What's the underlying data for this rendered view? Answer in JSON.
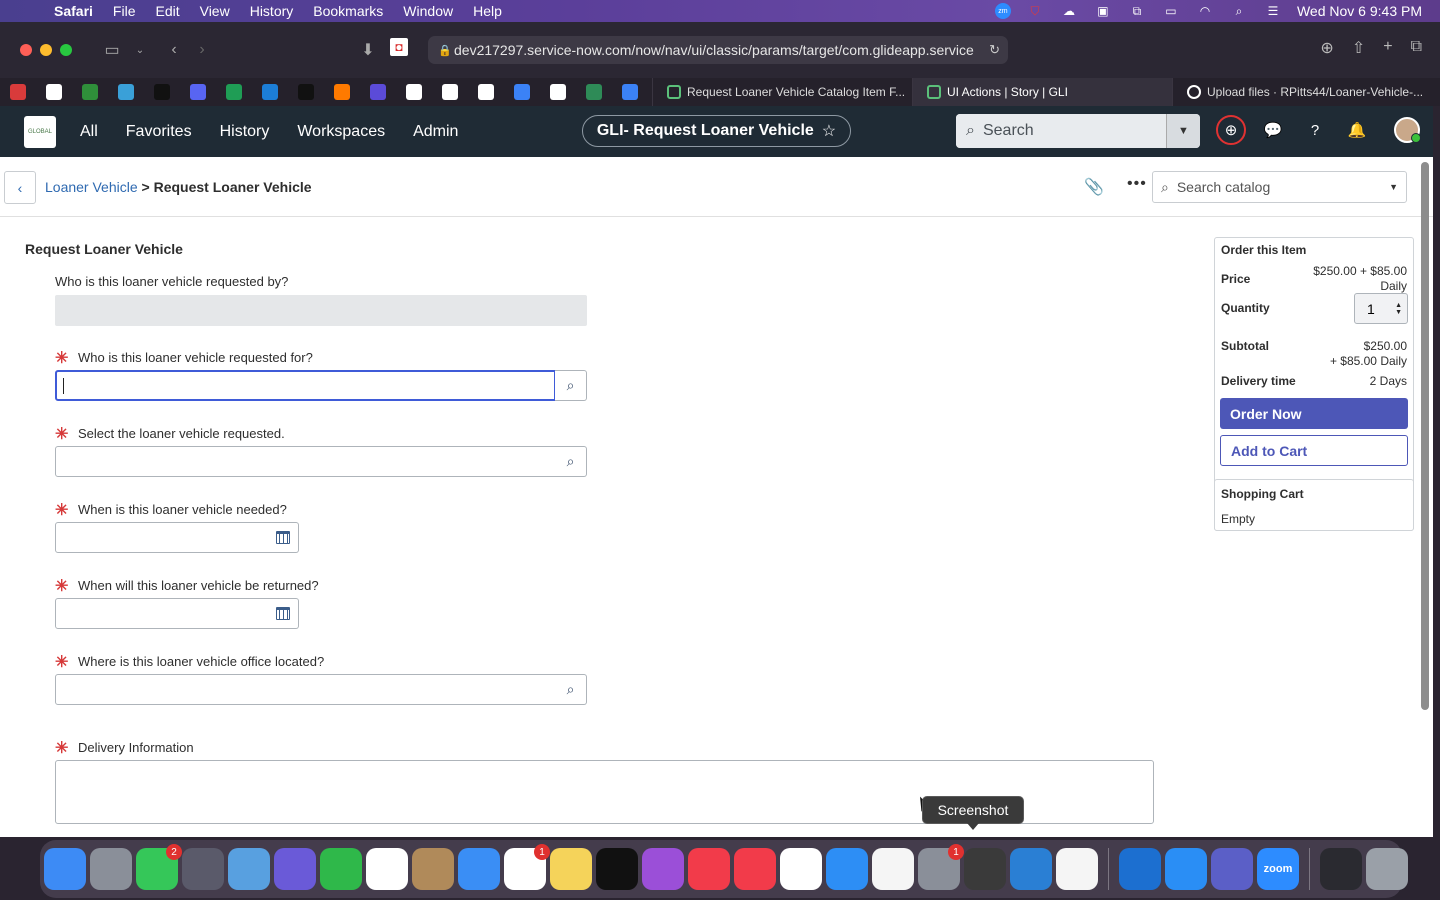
{
  "menubar": {
    "apple_glyph": "",
    "app": "Safari",
    "items": [
      "File",
      "Edit",
      "View",
      "History",
      "Bookmarks",
      "Window",
      "Help"
    ],
    "clock": "Wed Nov 6  9:43 PM"
  },
  "browser": {
    "url": "dev217297.service-now.com/now/nav/ui/classic/params/target/com.glideapp.service",
    "tabs": [
      {
        "title": "Request Loaner Vehicle Catalog Item F...",
        "active": false
      },
      {
        "title": "UI Actions | Story | GLI",
        "active": true
      },
      {
        "title": "Upload files · RPitts44/Loaner-Vehicle-...",
        "active": false
      }
    ],
    "favorite_colors": [
      "#d93b3b",
      "#ffffff",
      "#2f8f3a",
      "#3aa0d8",
      "#111111",
      "#5865f2",
      "#1f9d55",
      "#1c7ed6",
      "#111111",
      "#ff7a00",
      "#5b4bd8",
      "#ffffff",
      "#ffffff",
      "#ffffff",
      "#3b82f6",
      "#ffffff",
      "#2e8b57",
      "#3b82f6"
    ]
  },
  "sn_header": {
    "nav": [
      "All",
      "Favorites",
      "History",
      "Workspaces",
      "Admin"
    ],
    "title": "GLI- Request Loaner Vehicle",
    "search_placeholder": "Search",
    "logo_text": "GLOBAL"
  },
  "page": {
    "breadcrumb_parent": "Loaner Vehicle",
    "breadcrumb_sep": " > ",
    "breadcrumb_current": "Request Loaner Vehicle",
    "catalog_search_placeholder": "Search catalog",
    "form_title": "Request Loaner Vehicle",
    "questions": {
      "requested_by": "Who is this loaner vehicle requested by?",
      "requested_for": "Who is this loaner vehicle requested for?",
      "vehicle": "Select the loaner vehicle requested.",
      "needed": "When is this loaner vehicle needed?",
      "returned": "When will this loaner vehicle be returned?",
      "office": "Where is this loaner vehicle office located?",
      "delivery": "Delivery Information"
    },
    "required_mark": "✳"
  },
  "order": {
    "title": "Order this Item",
    "price_label": "Price",
    "price_line1": "$250.00 + $85.00",
    "price_line2": "Daily",
    "quantity_label": "Quantity",
    "quantity": "1",
    "subtotal_label": "Subtotal",
    "subtotal_line1": "$250.00",
    "subtotal_line2": "+ $85.00 Daily",
    "delivery_label": "Delivery time",
    "delivery_value": "2 Days",
    "order_now": "Order Now",
    "add_to_cart": "Add to Cart"
  },
  "cart": {
    "title": "Shopping Cart",
    "status": "Empty"
  },
  "tooltip": "Screenshot",
  "dock": {
    "apps": [
      {
        "name": "Finder",
        "color": "#3d8bf5"
      },
      {
        "name": "Launchpad",
        "color": "#8a8f99"
      },
      {
        "name": "Messages",
        "color": "#35c759",
        "badge": "2"
      },
      {
        "name": "Rocket",
        "color": "#5a5a6a"
      },
      {
        "name": "Maps",
        "color": "#58a0e0"
      },
      {
        "name": "Prism",
        "color": "#6a5ad8"
      },
      {
        "name": "FaceTime",
        "color": "#2fb84a"
      },
      {
        "name": "Calendar",
        "color": "#ffffff"
      },
      {
        "name": "Contacts",
        "color": "#b08a5a"
      },
      {
        "name": "Mail",
        "color": "#3a8ef5"
      },
      {
        "name": "Reminders",
        "color": "#ffffff",
        "badge": "1"
      },
      {
        "name": "Notes",
        "color": "#f5d35a"
      },
      {
        "name": "TV",
        "color": "#111111"
      },
      {
        "name": "Podcasts",
        "color": "#9b4fd8"
      },
      {
        "name": "News",
        "color": "#f23b4a"
      },
      {
        "name": "Music",
        "color": "#f23b4a"
      },
      {
        "name": "Notion",
        "color": "#ffffff"
      },
      {
        "name": "App Store",
        "color": "#2d8ef5"
      },
      {
        "name": "Photos",
        "color": "#f5f5f5"
      },
      {
        "name": "Settings",
        "color": "#8a8f99",
        "badge": "1"
      },
      {
        "name": "Screenshot",
        "color": "#3a3a3a"
      },
      {
        "name": "VS Code",
        "color": "#2a7fd4"
      },
      {
        "name": "Chrome",
        "color": "#f5f5f5"
      },
      {
        "name": "Outlook",
        "color": "#1c6fd0"
      },
      {
        "name": "Safari",
        "color": "#2a8ef5"
      },
      {
        "name": "Teams",
        "color": "#5b5fc7"
      },
      {
        "name": "Zoom",
        "color": "#2d8cff",
        "label": "zoom"
      },
      {
        "name": "Window",
        "color": "#2a2a30"
      },
      {
        "name": "Trash",
        "color": "#9aa0a8"
      }
    ]
  }
}
